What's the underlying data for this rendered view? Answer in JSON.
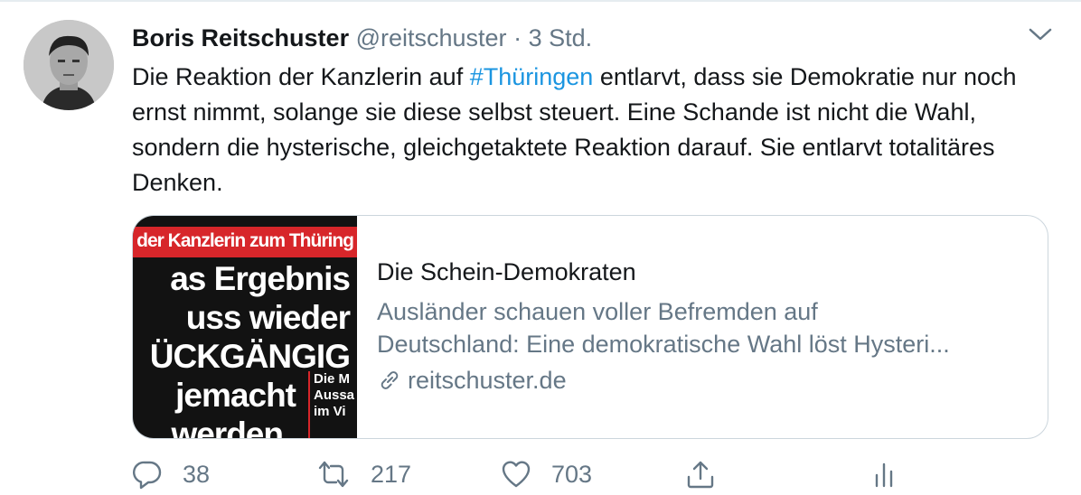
{
  "tweet": {
    "author_name": "Boris Reitschuster",
    "handle": "@reitschuster",
    "separator": "·",
    "time": "3 Std.",
    "text_before": "Die Reaktion der Kanzlerin auf ",
    "hashtag": "#Thüringen",
    "text_after": " entlarvt, dass sie Demokratie nur noch ernst nimmt, solange sie diese selbst steuert. Eine Schande ist nicht die Wahl, sondern die   hysterische, gleichgetaktete Reaktion darauf. Sie entlarvt totalitäres Denken."
  },
  "card": {
    "thumbnail": {
      "banner": "rte der Kanzlerin zum Thüring",
      "headline_lines": [
        "as Ergebnis",
        "uss wieder",
        "ÜCKGÄNGIG",
        "jemacht",
        "werden"
      ],
      "side_lines": [
        "Die M",
        "Aussa",
        "im Vi"
      ]
    },
    "title": "Die Schein-Demokraten",
    "description_line1": "Ausländer schauen voller Befremden auf",
    "description_line2": "Deutschland: Eine demokratische Wahl löst Hysteri...",
    "domain": "reitschuster.de"
  },
  "actions": {
    "reply_count": "38",
    "retweet_count": "217",
    "like_count": "703"
  },
  "icons": [
    "chevron-down-icon",
    "link-icon",
    "reply-icon",
    "retweet-icon",
    "like-icon",
    "share-icon",
    "analytics-icon"
  ],
  "colors": {
    "link": "#1b95e0",
    "secondary": "#657786",
    "text": "#14171a",
    "border": "#ccd6dd"
  }
}
